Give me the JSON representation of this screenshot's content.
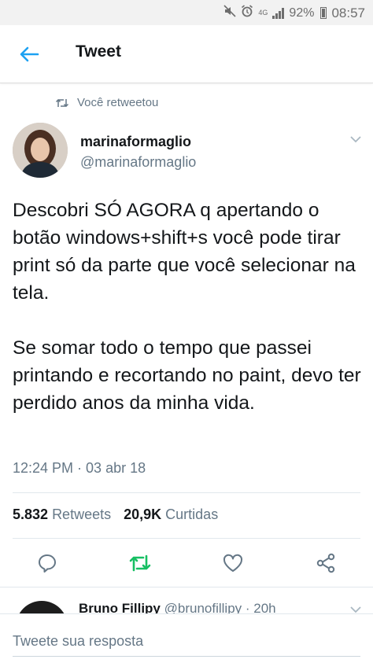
{
  "status_bar": {
    "network": "4G",
    "battery": "92%",
    "time": "08:57"
  },
  "header": {
    "title": "Tweet"
  },
  "retweet_context": {
    "label": "Você retweetou"
  },
  "tweet": {
    "author_name": "marinaformaglio",
    "author_handle": "@marinaformaglio",
    "text": "Descobri SÓ AGORA q apertando o botão windows+shift+s você pode tirar print só da parte que você selecionar na tela.\n\nSe somar todo o tempo que passei printando e recortando no paint, devo ter perdido anos da minha vida.",
    "timestamp": "12:24 PM · 03 abr 18",
    "retweets_count": "5.832",
    "retweets_label": "Retweets",
    "likes_count": "20,9K",
    "likes_label": "Curtidas"
  },
  "reply_preview": {
    "author_name": "Bruno Fillipy",
    "author_handle": "@brunofillipy",
    "time": "· 20h"
  },
  "compose": {
    "placeholder": "Tweete sua resposta"
  },
  "colors": {
    "accent": "#1da1f2",
    "retweeted": "#17bf63",
    "secondary_text": "#657786"
  }
}
